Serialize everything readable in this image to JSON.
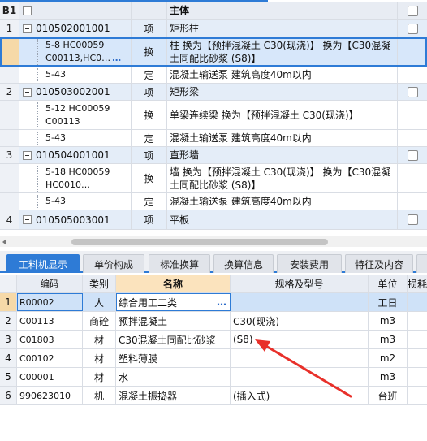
{
  "upper": {
    "corner_label": "B1",
    "header_title": "主体",
    "rows": [
      {
        "idx": "1",
        "code": "010502001001",
        "type": "项",
        "name": "矩形柱"
      },
      {
        "idx": "",
        "code": "5-8 HC00059 C00113,HC0…",
        "type": "换",
        "name": "柱  换为【预拌混凝土 C30(现浇)】  换为【C30混凝土同配比砂浆 (S8)】"
      },
      {
        "idx": "",
        "code": "5-43",
        "type": "定",
        "name": "混凝土输送泵 建筑高度40m以内"
      },
      {
        "idx": "2",
        "code": "010503002001",
        "type": "项",
        "name": "矩形梁"
      },
      {
        "idx": "",
        "code": "5-12 HC00059 C00113",
        "type": "换",
        "name": "单梁连续梁  换为【预拌混凝土 C30(现浇)】"
      },
      {
        "idx": "",
        "code": "5-43",
        "type": "定",
        "name": "混凝土输送泵 建筑高度40m以内"
      },
      {
        "idx": "3",
        "code": "010504001001",
        "type": "项",
        "name": "直形墙"
      },
      {
        "idx": "",
        "code": "5-18 HC00059 HC0010…",
        "type": "换",
        "name": "墙  换为【预拌混凝土 C30(现浇)】  换为【C30混凝土同配比砂浆 (S8)】"
      },
      {
        "idx": "",
        "code": "5-43",
        "type": "定",
        "name": "混凝土输送泵 建筑高度40m以内"
      },
      {
        "idx": "4",
        "code": "010505003001",
        "type": "项",
        "name": "平板"
      }
    ],
    "ellipsis": "…"
  },
  "tabs": [
    "工料机显示",
    "单价构成",
    "标准换算",
    "换算信息",
    "安装费用",
    "特征及内容"
  ],
  "lower": {
    "headers": {
      "code": "编码",
      "type": "类别",
      "name": "名称",
      "spec": "规格及型号",
      "unit": "单位",
      "loss": "损耗"
    },
    "rows": [
      {
        "idx": "1",
        "code": "R00002",
        "type": "人",
        "name": "综合用工二类",
        "spec": "",
        "unit": "工日"
      },
      {
        "idx": "2",
        "code": "C00113",
        "type": "商砼",
        "name": "预拌混凝土",
        "spec": "C30(现浇)",
        "unit": "m3"
      },
      {
        "idx": "3",
        "code": "C01803",
        "type": "材",
        "name": "C30混凝土同配比砂浆",
        "spec": "(S8)",
        "unit": "m3"
      },
      {
        "idx": "4",
        "code": "C00102",
        "type": "材",
        "name": "塑料薄膜",
        "spec": "",
        "unit": "m2"
      },
      {
        "idx": "5",
        "code": "C00001",
        "type": "材",
        "name": "水",
        "spec": "",
        "unit": "m3"
      },
      {
        "idx": "6",
        "code": "990623010",
        "type": "机",
        "name": "混凝土振捣器",
        "spec": "(插入式)",
        "unit": "台班"
      }
    ],
    "ellipsis": "…"
  },
  "colors": {
    "accent": "#2e7bd6",
    "arrow": "#e8302a",
    "header_highlight": "#fbe3bd"
  }
}
